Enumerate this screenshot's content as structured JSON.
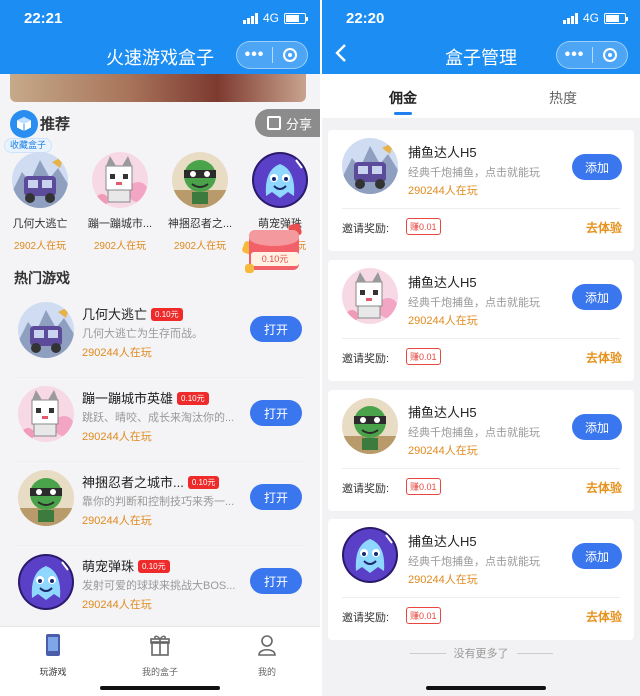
{
  "left": {
    "status": {
      "time": "22:21",
      "network": "4G"
    },
    "nav": {
      "title": "火速游戏盒子",
      "more": "•••"
    },
    "recommend": {
      "title": "推荐",
      "collect_label": "收藏盒子",
      "share_label": "分享"
    },
    "featured": [
      {
        "name": "几何大逃亡",
        "players": "2902人在玩",
        "art": "geo"
      },
      {
        "name": "蹦一蹦城市...",
        "players": "2902人在玩",
        "art": "cat"
      },
      {
        "name": "神捆忍者之...",
        "players": "2902人在玩",
        "art": "ninja"
      },
      {
        "name": "萌宠弹珠",
        "players": "2902人在玩",
        "art": "ghost"
      }
    ],
    "red_packet": {
      "amount": "0.10元"
    },
    "hot": {
      "title": "热门游戏",
      "items": [
        {
          "name": "几何大逃亡",
          "tag": "0.10元",
          "desc": "几何大逃亡为生存而战。",
          "players": "290244人在玩",
          "button": "打开",
          "art": "geo"
        },
        {
          "name": "蹦一蹦城市英雄",
          "tag": "0.10元",
          "desc": "跳跃、晴咬、成长来淘汰你的...",
          "players": "290244人在玩",
          "button": "打开",
          "art": "cat"
        },
        {
          "name": "神捆忍者之城市...",
          "tag": "0.10元",
          "desc": "靠你的判断和控制技巧来秀一...",
          "players": "290244人在玩",
          "button": "打开",
          "art": "ninja"
        },
        {
          "name": "萌宠弹珠",
          "tag": "0.10元",
          "desc": "发射可爱的球球来挑战大BOS...",
          "players": "290244人在玩",
          "button": "打开",
          "art": "ghost"
        }
      ]
    },
    "tabbar": [
      {
        "label": "玩游戏",
        "icon": "phone-icon",
        "active": true
      },
      {
        "label": "我的盒子",
        "icon": "gift-icon",
        "active": false
      },
      {
        "label": "我的",
        "icon": "user-icon",
        "active": false
      }
    ]
  },
  "right": {
    "status": {
      "time": "22:20",
      "network": "4G"
    },
    "nav": {
      "title": "盒子管理",
      "more": "•••"
    },
    "tabs": [
      {
        "label": "佣金",
        "active": true
      },
      {
        "label": "热度",
        "active": false
      }
    ],
    "cards": [
      {
        "name": "捕鱼达人H5",
        "desc": "经典千炮捕鱼，点击就能玩",
        "players": "290244人在玩",
        "button": "添加",
        "invite_label": "邀请奖励:",
        "earn": "赚0.01",
        "action": "去体验",
        "art": "geo"
      },
      {
        "name": "捕鱼达人H5",
        "desc": "经典千炮捕鱼，点击就能玩",
        "players": "290244人在玩",
        "button": "添加",
        "invite_label": "邀请奖励:",
        "earn": "赚0.01",
        "action": "去体验",
        "art": "cat"
      },
      {
        "name": "捕鱼达人H5",
        "desc": "经典千炮捕鱼，点击就能玩",
        "players": "290244人在玩",
        "button": "添加",
        "invite_label": "邀请奖励:",
        "earn": "赚0.01",
        "action": "去体验",
        "art": "ninja"
      },
      {
        "name": "捕鱼达人H5",
        "desc": "经典千炮捕鱼，点击就能玩",
        "players": "290244人在玩",
        "button": "添加",
        "invite_label": "邀请奖励:",
        "earn": "赚0.01",
        "action": "去体验",
        "art": "ghost"
      }
    ],
    "footer": "没有更多了"
  },
  "colors": {
    "primary": "#1c8df2",
    "button": "#3a76ee",
    "orange": "#e08a1e",
    "red": "#ee2a2a"
  }
}
